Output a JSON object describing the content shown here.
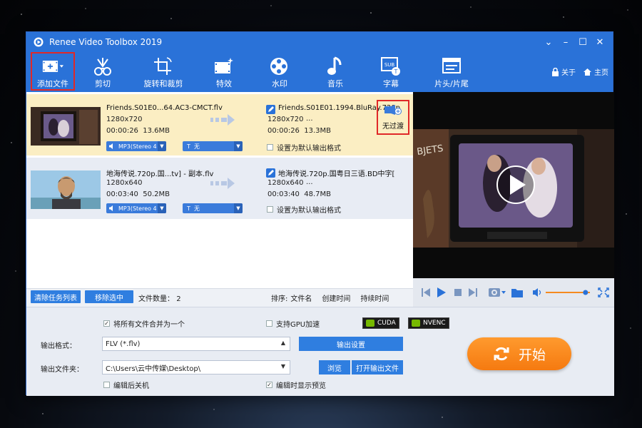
{
  "window": {
    "title": "Renee Video Toolbox 2019"
  },
  "toolbar": {
    "items": [
      {
        "label": "添加文件",
        "icon": "film-plus-icon"
      },
      {
        "label": "剪切",
        "icon": "scissors-icon"
      },
      {
        "label": "旋转和裁剪",
        "icon": "crop-rotate-icon"
      },
      {
        "label": "特效",
        "icon": "film-effects-icon"
      },
      {
        "label": "水印",
        "icon": "film-reel-icon"
      },
      {
        "label": "音乐",
        "icon": "music-note-icon"
      },
      {
        "label": "字幕",
        "icon": "subtitle-icon"
      },
      {
        "label": "片头/片尾",
        "icon": "title-card-icon"
      }
    ],
    "close_label": "关于",
    "home_label": "主页"
  },
  "files": [
    {
      "input_name": "Friends.S01E0...64.AC3-CMCT.flv",
      "input_res": "1280x720",
      "input_duration": "00:00:26",
      "input_size": "13.6MB",
      "audio": "MP3(Stereo 4",
      "subtitle": "无",
      "output_name": "Friends.S01E01.1994.BluRay.720p",
      "output_res": "1280x720",
      "output_dots": "...",
      "output_duration": "00:00:26",
      "output_size": "13.3MB",
      "default_label": "设置为默认输出格式",
      "transition_label": "无过渡"
    },
    {
      "input_name": "地海传说.720p.国...tv] - 副本.flv",
      "input_res": "1280x640",
      "input_duration": "00:03:40",
      "input_size": "50.2MB",
      "audio": "MP3(Stereo 4",
      "subtitle": "无",
      "output_name": "地海传说.720p.国粤日三语.BD中字[",
      "output_res": "1280x640",
      "output_dots": "...",
      "output_duration": "00:03:40",
      "output_size": "48.7MB",
      "default_label": "设置为默认输出格式"
    }
  ],
  "listbar": {
    "clear_label": "清除任务列表",
    "remove_label": "移除选中",
    "count_label": "文件数量：",
    "count": "2",
    "sort_label": "排序:",
    "sort_options": [
      "文件名",
      "创建时间",
      "持续时间"
    ]
  },
  "bottom": {
    "merge_label": "将所有文件合并为一个",
    "gpu_label": "支持GPU加速",
    "cuda_label": "CUDA",
    "nvenc_label": "NVENC",
    "format_label": "输出格式：",
    "format_value": "FLV (*.flv)",
    "output_settings_label": "输出设置",
    "folder_label": "输出文件夹：",
    "folder_value": "C:\\Users\\云中传媒\\Desktop\\",
    "browse_label": "浏览",
    "open_folder_label": "打开输出文件",
    "shutdown_label": "编辑后关机",
    "preview_label": "编辑时显示预览",
    "start_label": "开始"
  },
  "player": {
    "volume_fraction": 0.9
  },
  "colors": {
    "accent": "#2a72d8",
    "start": "#f58a1f",
    "highlight": "#fbeec3",
    "alert": "#e02828"
  }
}
